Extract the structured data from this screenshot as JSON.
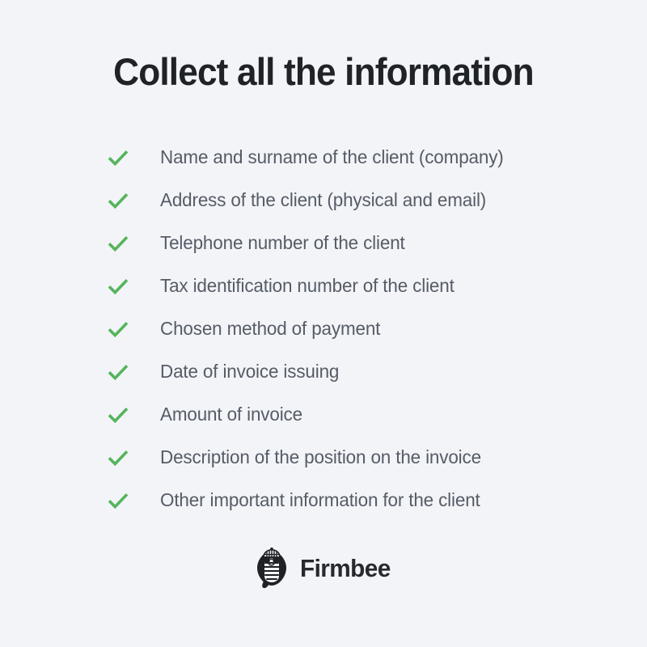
{
  "page": {
    "background_color": "#f2f4f8",
    "title": "Collect all the information",
    "title_color": "#1f2226"
  },
  "checklist": {
    "icon_name": "check-icon",
    "icon_color": "#55b45c",
    "text_color": "#565c66",
    "items": [
      {
        "label": "Name and surname of the client (company)"
      },
      {
        "label": "Address of the client (physical and email)"
      },
      {
        "label": "Telephone number of the client"
      },
      {
        "label": "Tax identification number of the client"
      },
      {
        "label": "Chosen method of payment"
      },
      {
        "label": "Date of invoice issuing"
      },
      {
        "label": "Amount of invoice"
      },
      {
        "label": "Description of the position on the invoice"
      },
      {
        "label": "Other important information for the client"
      }
    ]
  },
  "footer": {
    "logo_mark_name": "firmbee-bee-logo-icon",
    "wordmark": "Firmbee",
    "wordmark_color": "#26292d"
  }
}
